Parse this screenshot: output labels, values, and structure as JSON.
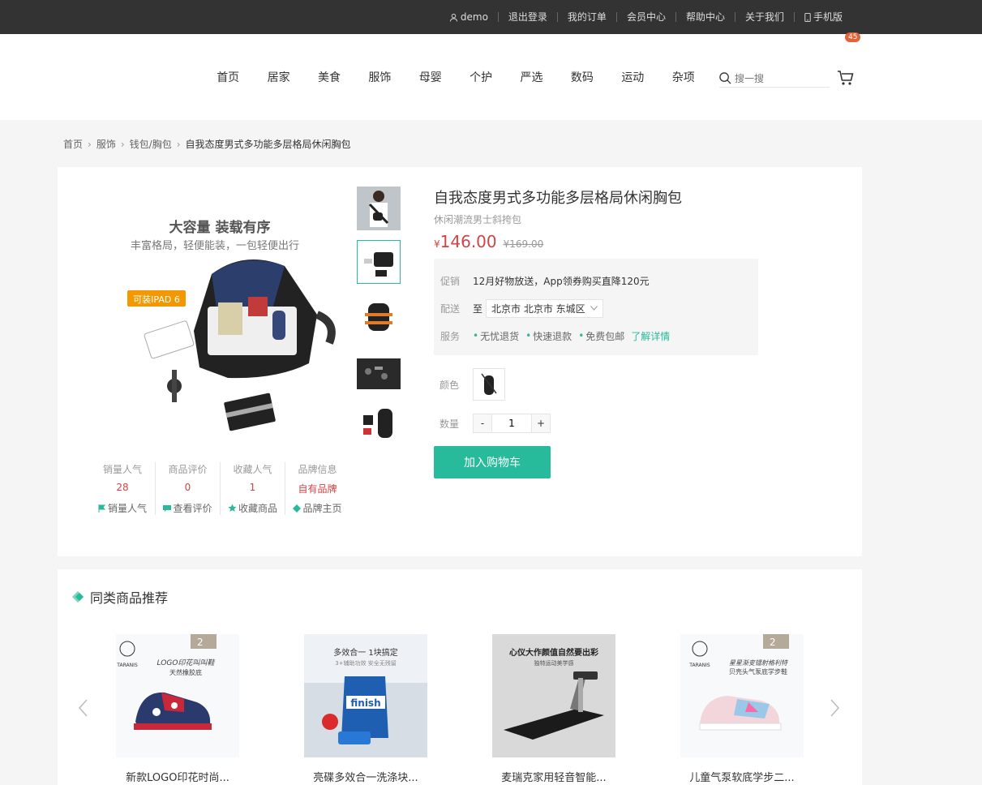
{
  "topbar": {
    "user": "demo",
    "logout": "退出登录",
    "orders": "我的订单",
    "member": "会员中心",
    "help": "帮助中心",
    "about": "关于我们",
    "mobile": "手机版"
  },
  "nav": [
    "首页",
    "居家",
    "美食",
    "服饰",
    "母婴",
    "个护",
    "严选",
    "数码",
    "运动",
    "杂项"
  ],
  "search": {
    "placeholder": "搜一搜"
  },
  "cart": {
    "count": "45"
  },
  "breadcrumb": [
    "首页",
    "服饰",
    "钱包/胸包",
    "自我态度男式多功能多层格局休闲胸包"
  ],
  "gallery": {
    "headline": "大容量  装载有序",
    "subline": "丰富格局，轻便能装，一包轻便出行",
    "tag": "可装IPAD 6"
  },
  "stats": [
    {
      "label": "销量人气",
      "value": "28",
      "action": "销量人气",
      "icon": "flag-icon"
    },
    {
      "label": "商品评价",
      "value": "0",
      "action": "查看评价",
      "icon": "comment-icon"
    },
    {
      "label": "收藏人气",
      "value": "1",
      "action": "收藏商品",
      "icon": "star-icon"
    },
    {
      "label": "品牌信息",
      "value": "自有品牌",
      "action": "品牌主页",
      "icon": "brand-icon"
    }
  ],
  "product": {
    "title": "自我态度男式多功能多层格局休闲胸包",
    "subtitle": "休闲潮流男士斜挎包",
    "currency": "¥",
    "price": "146.00",
    "old_price": "169.00",
    "promo_label": "促销",
    "promo_text": "12月好物放送，App领券购买直降120元",
    "ship_label": "配送",
    "ship_to": "至",
    "address": "北京市 北京市 东城区",
    "service_label": "服务",
    "services": [
      "无忧退货",
      "快速退款",
      "免费包邮"
    ],
    "service_link": "了解详情",
    "color_label": "颜色",
    "qty_label": "数量",
    "qty": "1",
    "add_to_cart": "加入购物车"
  },
  "recommend": {
    "title": "同类商品推荐",
    "items": [
      {
        "name": "新款LOGO印花时尚..."
      },
      {
        "name": "亮碟多效合一洗涤块..."
      },
      {
        "name": "麦瑞克家用轻音智能..."
      },
      {
        "name": "儿童气泵软底学步二..."
      }
    ],
    "img_texts": {
      "shoe_slogan": "LOGO印花叫叫鞋",
      "shoe_sub": "天然橡胶底",
      "finish_head": "多效合一  1块搞定",
      "finish_sub": "3+辅助功效  安全无残留",
      "finish_brand": "finish",
      "tread_head": "心仪大作颜值自然要出彩",
      "tread_sub": "独特运动美学感",
      "shoe2_slogan": "星星渐变镭射格利特",
      "shoe2_sub": "贝壳头气泵底学步鞋",
      "brand": "TARANIS",
      "badge": "2"
    }
  }
}
